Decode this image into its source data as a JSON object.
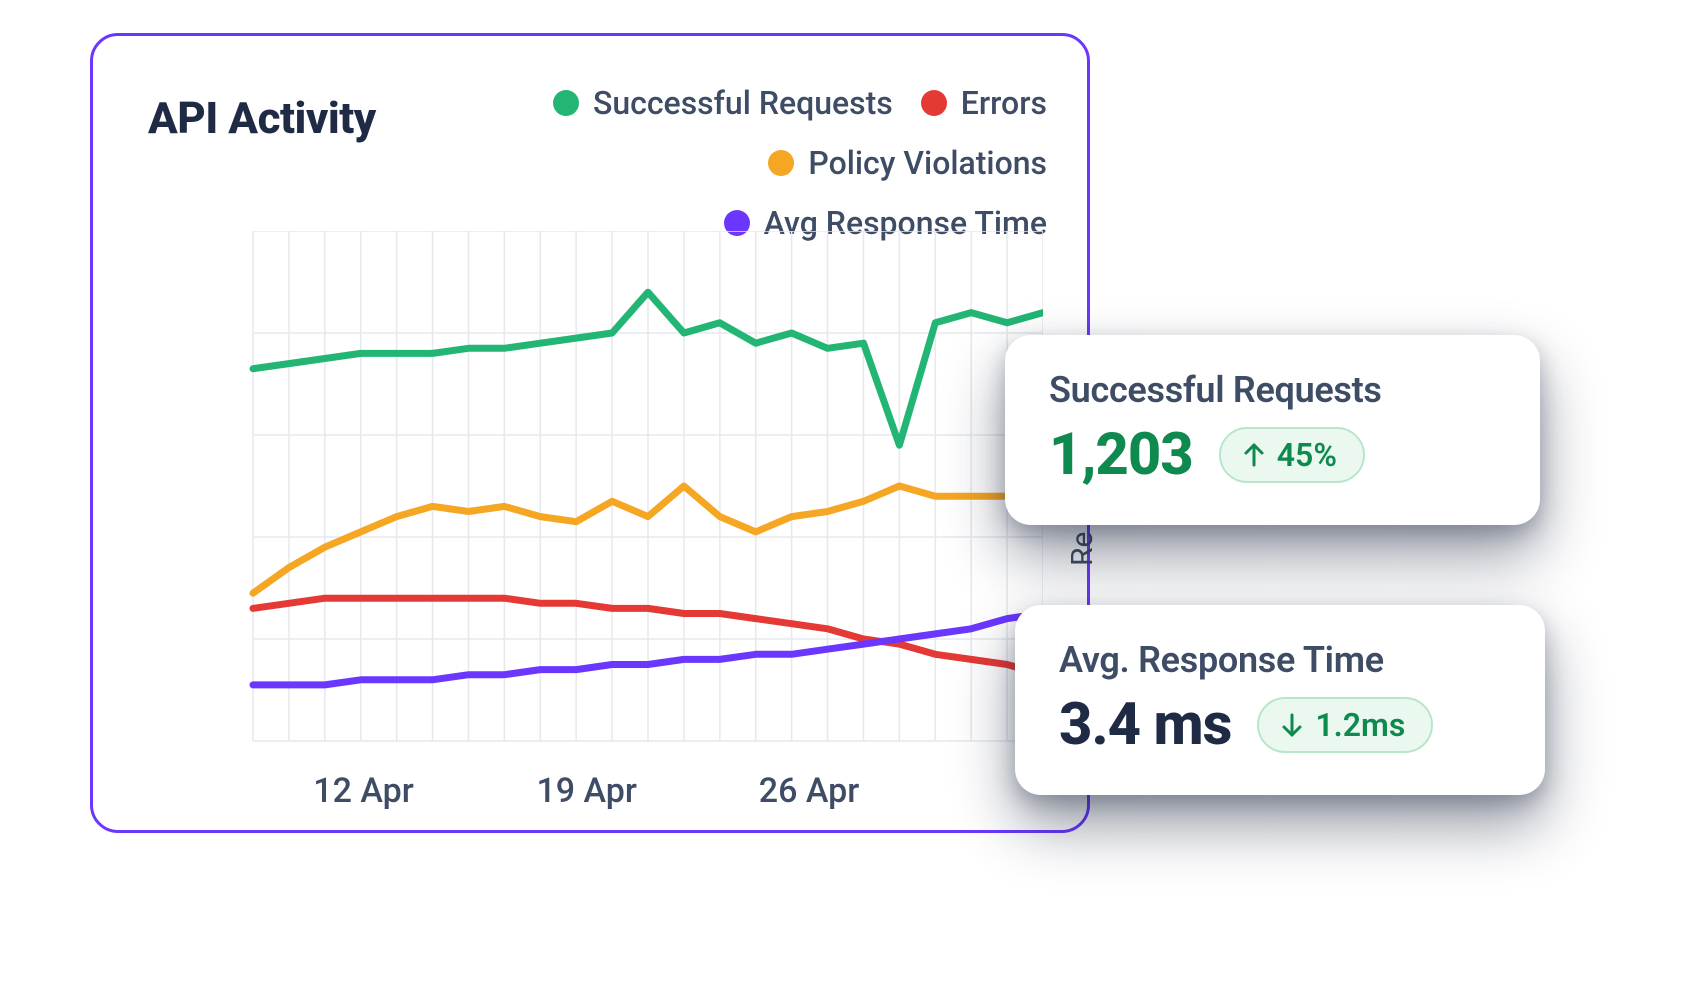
{
  "panel": {
    "title": "API Activity"
  },
  "legend": [
    {
      "label": "Successful Requests",
      "color": "#22B573"
    },
    {
      "label": "Errors",
      "color": "#E53935"
    },
    {
      "label": "Policy Violations",
      "color": "#F5A623"
    },
    {
      "label": "Avg Response Time",
      "color": "#6B37FF"
    }
  ],
  "x_ticks": [
    {
      "label": "12 Apr",
      "pos": 0.245
    },
    {
      "label": "19 Apr",
      "pos": 0.493
    },
    {
      "label": "26 Apr",
      "pos": 0.74
    }
  ],
  "clipped_axis_label": "Re",
  "stats": {
    "successful": {
      "label": "Successful Requests",
      "value": "1,203",
      "delta": "45%",
      "direction": "up"
    },
    "response_time": {
      "label": "Avg. Response Time",
      "value": "3.4 ms",
      "delta": "1.2ms",
      "direction": "down"
    }
  },
  "chart_data": {
    "type": "line",
    "title": "API Activity",
    "xlabel": "",
    "x_ticks_visible": [
      "12 Apr",
      "19 Apr",
      "26 Apr"
    ],
    "x_days": [
      8,
      9,
      10,
      11,
      12,
      13,
      14,
      15,
      16,
      17,
      18,
      19,
      20,
      21,
      22,
      23,
      24,
      25,
      26,
      27,
      28,
      29,
      30
    ],
    "series": [
      {
        "name": "Successful Requests",
        "color": "#22B573",
        "values": [
          73,
          74,
          75,
          76,
          76,
          76,
          77,
          77,
          78,
          79,
          80,
          88,
          80,
          82,
          78,
          80,
          77,
          78,
          58,
          82,
          84,
          82,
          84
        ]
      },
      {
        "name": "Policy Violations",
        "color": "#F5A623",
        "values": [
          29,
          34,
          38,
          41,
          44,
          46,
          45,
          46,
          44,
          43,
          47,
          44,
          50,
          44,
          41,
          44,
          45,
          47,
          50,
          48,
          48,
          48,
          49
        ]
      },
      {
        "name": "Errors",
        "color": "#E53935",
        "values": [
          26,
          27,
          28,
          28,
          28,
          28,
          28,
          28,
          27,
          27,
          26,
          26,
          25,
          25,
          24,
          23,
          22,
          20,
          19,
          17,
          16,
          15,
          13
        ]
      },
      {
        "name": "Avg Response Time",
        "color": "#6B37FF",
        "values": [
          11,
          11,
          11,
          12,
          12,
          12,
          13,
          13,
          14,
          14,
          15,
          15,
          16,
          16,
          17,
          17,
          18,
          19,
          20,
          21,
          22,
          24,
          25
        ]
      }
    ],
    "ylim": [
      0,
      100
    ],
    "xlim_days": [
      8,
      30
    ],
    "grid": true
  }
}
